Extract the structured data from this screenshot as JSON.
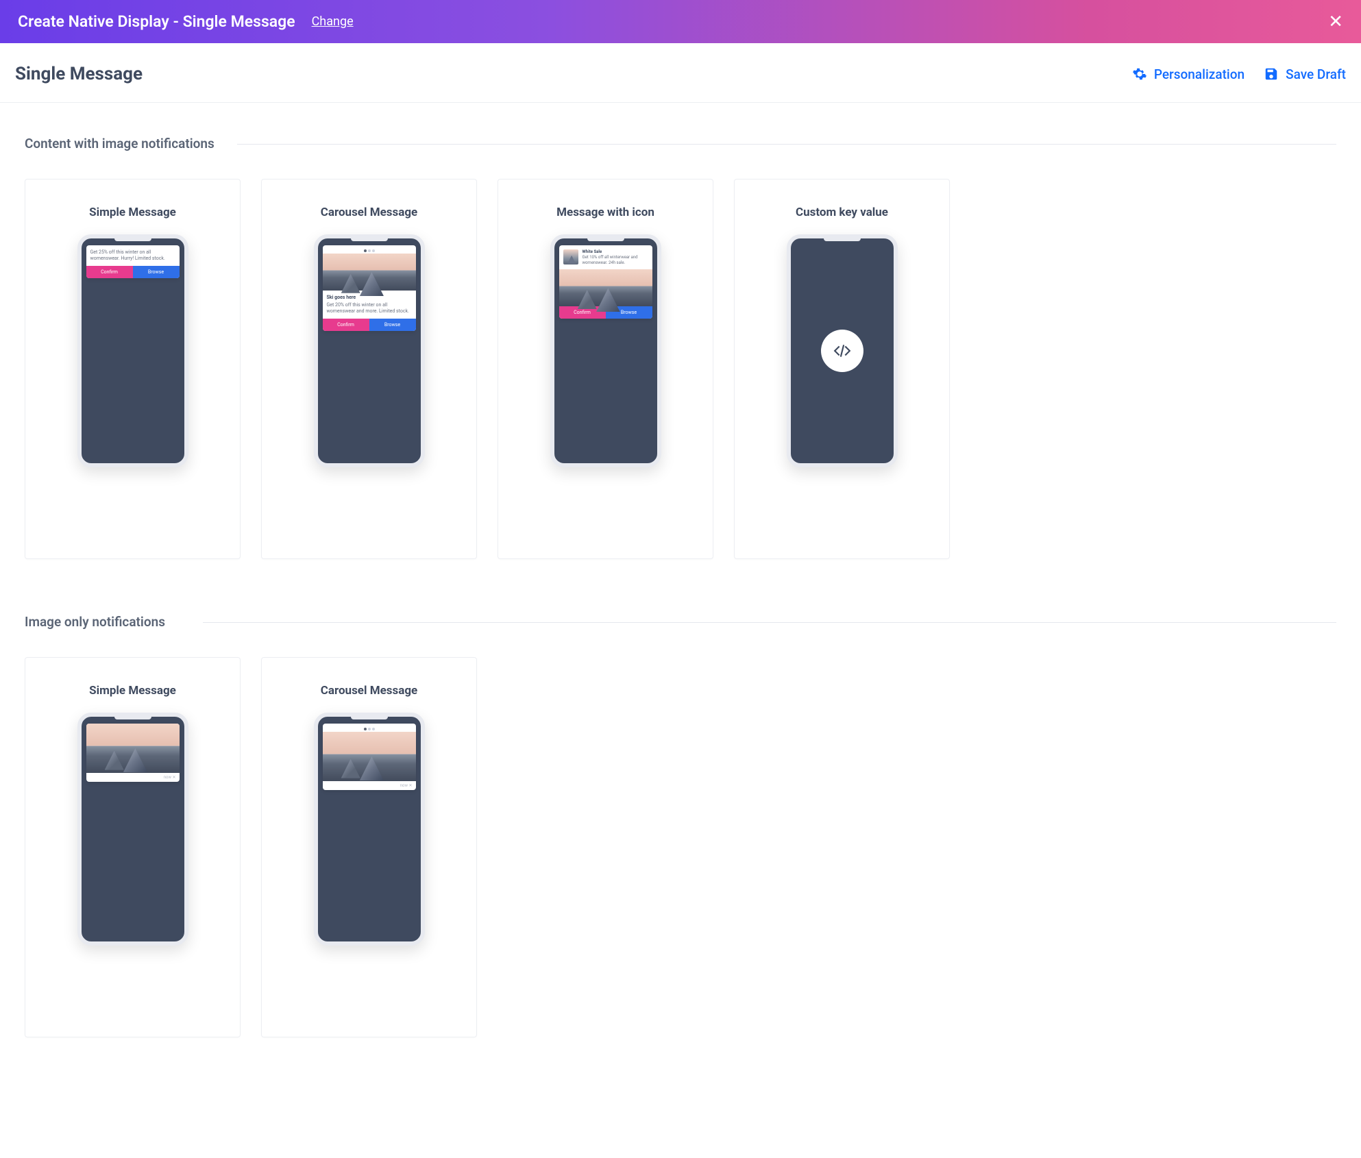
{
  "topbar": {
    "title": "Create Native Display - Single Message",
    "change": "Change"
  },
  "subheader": {
    "title": "Single Message",
    "personalization": "Personalization",
    "save_draft": "Save Draft"
  },
  "sections": {
    "content_with_image": "Content with image notifications",
    "image_only": "Image only notifications"
  },
  "cards": {
    "simple": "Simple Message",
    "carousel": "Carousel Message",
    "with_icon": "Message with icon",
    "custom_kv": "Custom key value"
  }
}
